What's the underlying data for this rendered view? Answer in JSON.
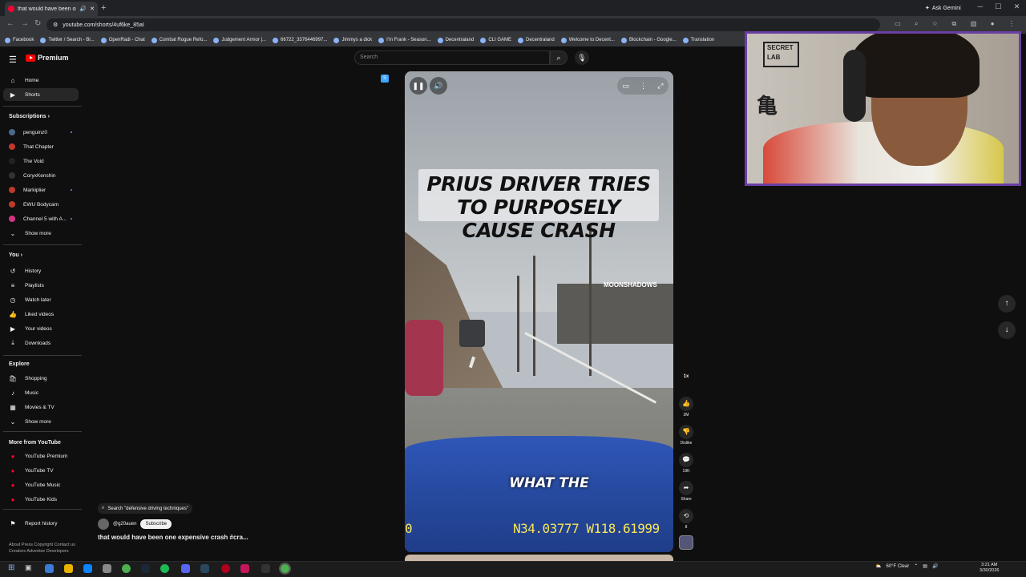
{
  "browser": {
    "tab_title": "that would have been one ...",
    "address": "youtube.com/shorts/4uf6ke_85aI",
    "ask_gemini": "Ask Gemini",
    "bookmarks": [
      "Facebook",
      "Twitter / Search - Bi...",
      "OpenRadi - Chat",
      "Combat Rogue Refo...",
      "Judgement Armor |...",
      "66722_3376446997...",
      "Jimmys a dick",
      "I'm Frank - Season...",
      "Decentraland",
      "CLI GAME",
      "Decentraland",
      "Welcome to Decent...",
      "Blockchain - Google...",
      "Translation"
    ]
  },
  "youtube": {
    "logo_text": "Premium",
    "search_placeholder": "Search"
  },
  "sidebar": {
    "top": [
      {
        "label": "Home",
        "icon": "home-icon"
      },
      {
        "label": "Shorts",
        "icon": "shorts-icon"
      }
    ],
    "subscriptions_heading": "Subscriptions",
    "subscriptions": [
      {
        "label": "penguinz0",
        "color": "#4a6a8a",
        "dot": true
      },
      {
        "label": "That Chapter",
        "color": "#c0392b",
        "dot": false
      },
      {
        "label": "The Void",
        "color": "#222222",
        "dot": false
      },
      {
        "label": "CoryxKenshin",
        "color": "#333333",
        "dot": false
      },
      {
        "label": "Markiplier",
        "color": "#c0392b",
        "dot": true
      },
      {
        "label": "EWU Bodycam",
        "color": "#c0392b",
        "dot": false
      },
      {
        "label": "Channel 5 with A...",
        "color": "#d63384",
        "dot": true
      }
    ],
    "show_more": "Show more",
    "you_heading": "You",
    "you_items": [
      {
        "label": "History",
        "icon": "history-icon"
      },
      {
        "label": "Playlists",
        "icon": "playlists-icon"
      },
      {
        "label": "Watch later",
        "icon": "watch-later-icon"
      },
      {
        "label": "Liked videos",
        "icon": "liked-videos-icon"
      },
      {
        "label": "Your videos",
        "icon": "your-videos-icon"
      },
      {
        "label": "Downloads",
        "icon": "downloads-icon"
      }
    ],
    "explore_heading": "Explore",
    "explore_items": [
      {
        "label": "Shopping",
        "icon": "shopping-icon"
      },
      {
        "label": "Music",
        "icon": "music-icon"
      },
      {
        "label": "Movies & TV",
        "icon": "movies-icon"
      },
      {
        "label": "Show more",
        "icon": "chevron-down-icon"
      }
    ],
    "more_heading": "More from YouTube",
    "more_items": [
      "YouTube Premium",
      "YouTube TV",
      "YouTube Music",
      "YouTube Kids"
    ],
    "report_history": "Report history",
    "footer": "About  Press  Copyright  Contact us  Creators  Advertise  Developers"
  },
  "short": {
    "overlay_title": "PRIUS DRIVER TRIES TO PURPOSELY CAUSE CRASH",
    "building_sign": "MOONSHADOWS",
    "caption": "WHAT THE",
    "coords": "N34.03777 W118.61999",
    "coord_left": "0",
    "search_suggestion": "Search \"defensive driving techniques\"",
    "channel": "@g20auen",
    "subscribe": "Subscribe",
    "title": "that would have been one expensive crash #cra...",
    "speed": "1x",
    "likes": "2M",
    "dislike": "Dislike",
    "comments": "19K",
    "share": "Share",
    "remix_count": "8"
  },
  "webcam": {
    "sign_text": "SECRET LAB",
    "kanji": "亀"
  },
  "taskbar": {
    "weather": "60°F  Clear",
    "time": "3:21 AM",
    "date": "3/30/2026"
  }
}
